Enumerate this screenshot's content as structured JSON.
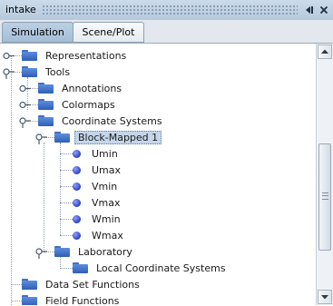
{
  "window": {
    "title": "intake",
    "pin_glyph": "◀▮",
    "close_glyph": "✕"
  },
  "tabs": [
    {
      "label": "Simulation",
      "active": true
    },
    {
      "label": "Scene/Plot",
      "active": false
    }
  ],
  "tree": {
    "representations": "Representations",
    "tools": "Tools",
    "annotations": "Annotations",
    "colormaps": "Colormaps",
    "coordinate_systems": "Coordinate Systems",
    "block_mapped": "Block-Mapped 1",
    "umin": "Umin",
    "umax": "Umax",
    "vmin": "Vmin",
    "vmax": "Vmax",
    "wmin": "Wmin",
    "wmax": "Wmax",
    "laboratory": "Laboratory",
    "local_coordinate_systems": "Local Coordinate Systems",
    "data_set_functions": "Data Set Functions",
    "field_functions": "Field Functions"
  },
  "colors": {
    "selection": "#c5d6ea",
    "folder": "#3a6cc4",
    "title_bar": "#b5c9dc"
  }
}
